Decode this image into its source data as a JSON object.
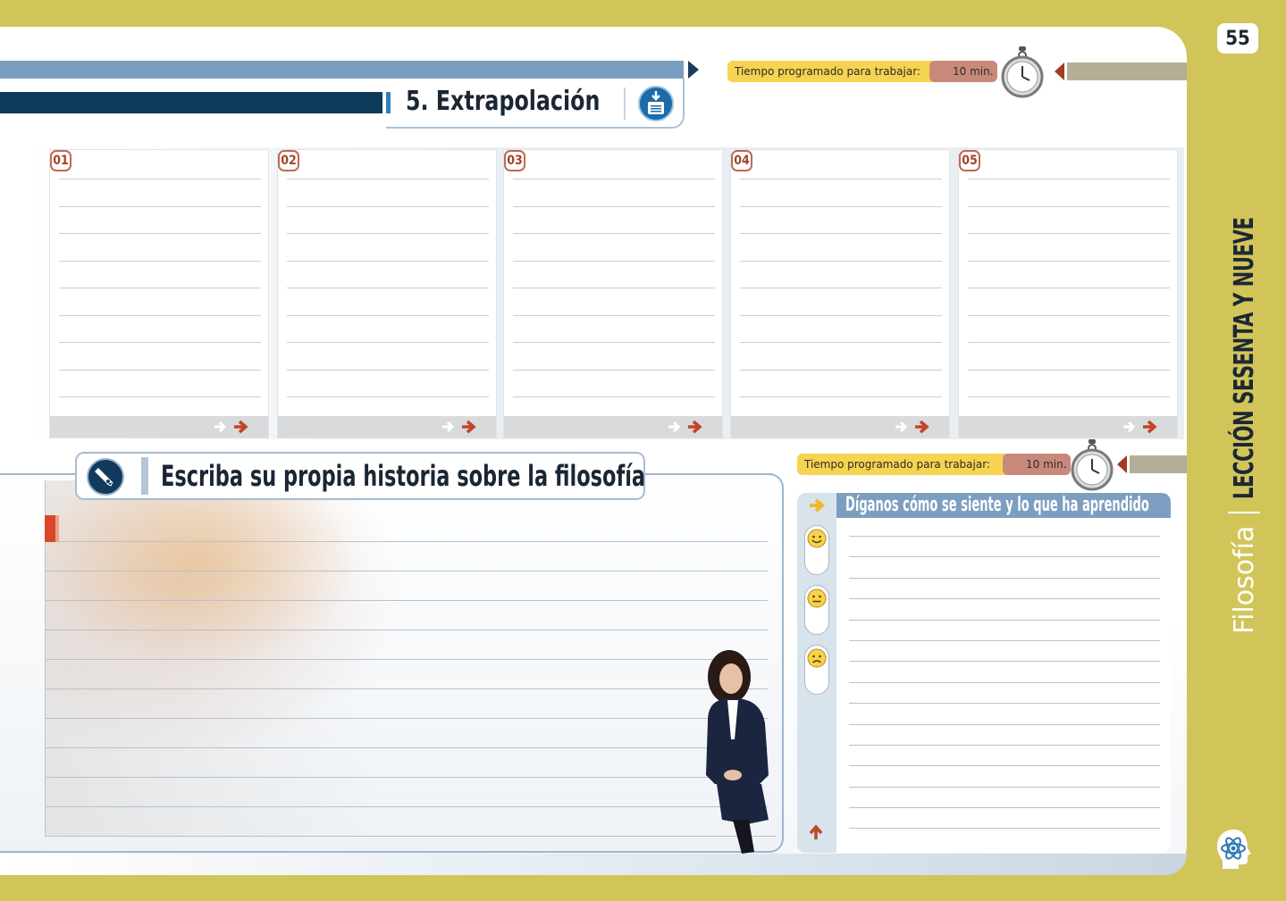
{
  "page": {
    "number": "55",
    "subject": "Filosofía",
    "lesson_title": "LECCIÓN SESENTA Y NUEVE"
  },
  "section": {
    "title": "5. Extrapolación"
  },
  "timer_top": {
    "label": "Tiempo programado para trabajar:",
    "value": "10 min."
  },
  "timer_bottom": {
    "label": "Tiempo programado para trabajar:",
    "value": "10 min."
  },
  "boxes": [
    {
      "number": "01"
    },
    {
      "number": "02"
    },
    {
      "number": "03"
    },
    {
      "number": "04"
    },
    {
      "number": "05"
    }
  ],
  "writing": {
    "title": "Escriba su propia historia sobre la filosofía"
  },
  "feelings": {
    "title": "Díganos cómo se siente y lo que ha aprendido",
    "faces": [
      "happy-face-icon",
      "neutral-face-icon",
      "sad-face-icon"
    ]
  },
  "colors": {
    "background": "#d1c55a",
    "header_blue": "#7a9ec0",
    "header_dark": "#0e3a5c",
    "timer_label": "#f6d350",
    "timer_value": "#c9897a",
    "accent_red": "#a33a22"
  }
}
